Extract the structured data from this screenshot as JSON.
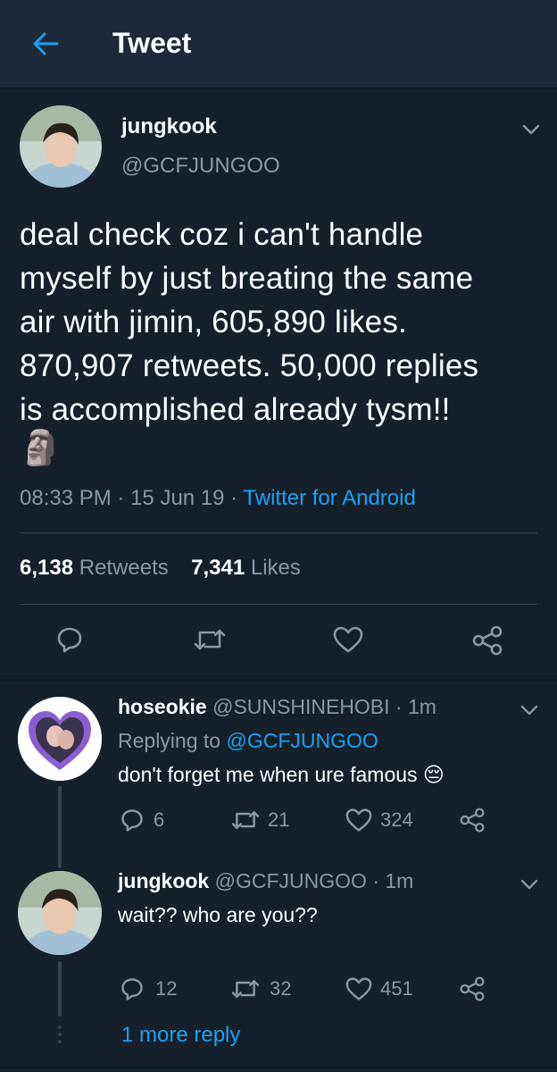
{
  "header": {
    "title": "Tweet"
  },
  "main_tweet": {
    "display_name": "jungkook",
    "handle": "@GCFJUNGOO",
    "text_lines": [
      "deal check coz i can't handle",
      "myself by just breating the same",
      "air with jimin, 605,890 likes.",
      "870,907 retweets. 50,000 replies",
      "is accomplished already tysm!!"
    ],
    "emoji": "🗿",
    "time": "08:33 PM",
    "date": "15 Jun 19",
    "source": "Twitter for Android",
    "separator": "·",
    "retweets_count": "6,138",
    "retweets_label": "Retweets",
    "likes_count": "7,341",
    "likes_label": "Likes"
  },
  "replies": [
    {
      "display_name": "hoseokie",
      "handle": "@SUNSHINEHOBI",
      "age": "· 1m",
      "replying_prefix": "Replying to",
      "replying_to": "@GCFJUNGOO",
      "text": "don't forget me when ure famous",
      "emoji": "😔",
      "reply_count": "6",
      "retweet_count": "21",
      "like_count": "324"
    },
    {
      "display_name": "jungkook",
      "handle": "@GCFJUNGOO",
      "age": "· 1m",
      "text": "wait?? who are you??",
      "reply_count": "12",
      "retweet_count": "32",
      "like_count": "451"
    }
  ],
  "more_replies": "1 more reply",
  "colors": {
    "background": "#15202b",
    "header": "#1c2938",
    "accent": "#1da1f2",
    "muted": "#8899a6",
    "divider": "#38444d"
  },
  "icons": [
    "back-arrow-icon",
    "chevron-down-icon",
    "reply-icon",
    "retweet-icon",
    "like-icon",
    "share-icon"
  ]
}
